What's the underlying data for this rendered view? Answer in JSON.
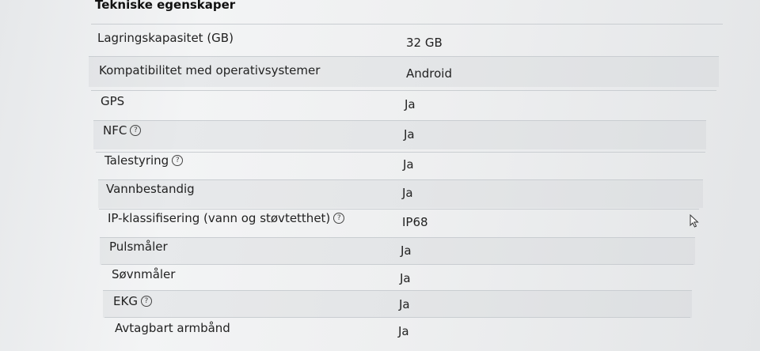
{
  "section": {
    "title": "Tekniske egenskaper"
  },
  "rows": [
    {
      "label": "Lagringskapasitet (GB)",
      "value": "32 GB"
    },
    {
      "label": "Kompatibilitet med operativsystemer",
      "value": "Android"
    },
    {
      "label": "GPS",
      "value": "Ja"
    },
    {
      "label": "NFC",
      "value": "Ja",
      "info_icon": "question-icon"
    },
    {
      "label": "Talestyring",
      "value": "Ja",
      "info_icon": "question-icon"
    },
    {
      "label": "Vannbestandig",
      "value": "Ja"
    },
    {
      "label": "IP-klassifisering (vann og støvtetthet)",
      "value": "IP68",
      "info_icon": "question-icon"
    },
    {
      "label": "Pulsmåler",
      "value": "Ja"
    },
    {
      "label": "Søvnmåler",
      "value": "Ja"
    },
    {
      "label": "EKG",
      "value": "Ja",
      "info_icon": "question-icon"
    },
    {
      "label": "Avtagbart armbånd",
      "value": "Ja"
    }
  ],
  "info_icon_glyph": "?"
}
